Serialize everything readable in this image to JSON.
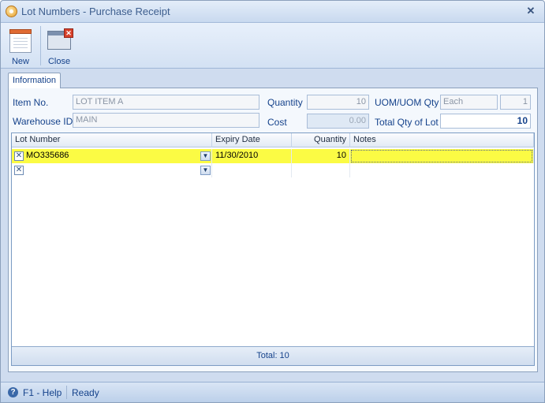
{
  "window": {
    "title": "Lot Numbers - Purchase Receipt"
  },
  "toolbar": {
    "new_label": "New",
    "close_label": "Close"
  },
  "tab": {
    "label": "Information"
  },
  "form": {
    "item_no_label": "Item No.",
    "item_no_value": "LOT ITEM A",
    "warehouse_label": "Warehouse ID",
    "warehouse_value": "MAIN",
    "quantity_label": "Quantity",
    "quantity_value": "10",
    "cost_label": "Cost",
    "cost_value": "0.00",
    "uom_label": "UOM/UOM Qty",
    "uom_value": "Each",
    "uom_qty_value": "1",
    "total_lot_label": "Total Qty of Lot",
    "total_lot_value": "10"
  },
  "grid": {
    "columns": [
      "Lot Number",
      "Expiry Date",
      "Quantity",
      "Notes"
    ],
    "rows": [
      {
        "lot_number": "MO335686",
        "expiry_date": "11/30/2010",
        "quantity": "10",
        "notes": ""
      }
    ],
    "footer_total": "Total: 10"
  },
  "status": {
    "help": "F1 - Help",
    "state": "Ready"
  },
  "colors": {
    "selected_row": "#fbfb44",
    "accent": "#15428b"
  }
}
